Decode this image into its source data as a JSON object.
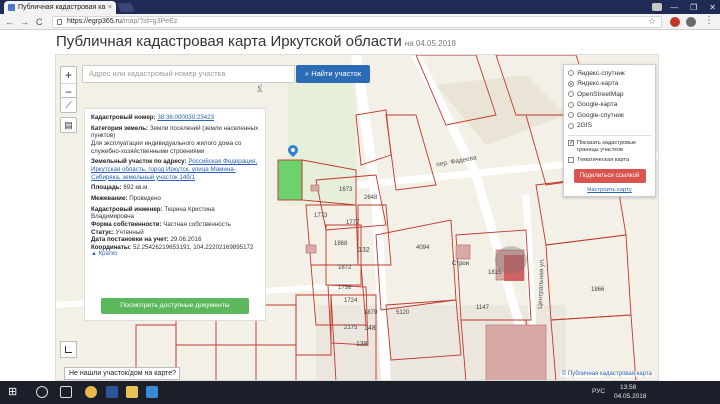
{
  "browser": {
    "tab_title": "Публичная кадастровая ка",
    "tab_close": "×",
    "url_host": "https://egrp365.ru",
    "url_path": "/map/?id=g3PeEz",
    "back": "←",
    "forward": "→",
    "reload": "C",
    "star": "☆",
    "menu": "⋮",
    "window_controls": [
      "—",
      "❐",
      "✕"
    ]
  },
  "page": {
    "title": "Публичная кадастровая карта Иркутской области",
    "date": "на 04.05.2018"
  },
  "map": {
    "zoom_in": "+",
    "zoom_out": "−",
    "search_placeholder": "Адрес или кадастровый номер участка",
    "search_button": "Найти участок",
    "not_found": "Не нашли участок/дом на карте?",
    "attribution": "© Публичная кадастровая карта",
    "labels": {
      "street1": "ул. Ма",
      "street2": "пер. Фадеева",
      "street3": "Центральная ул.",
      "l1": "1673",
      "l2": "2648",
      "l3": "1773",
      "l4": "1777",
      "l5": "1868",
      "l6": "132",
      "l7": "1872",
      "l8": "1738",
      "l9": "1724",
      "l10": "1879",
      "l11": "2175",
      "l12": "148",
      "l13": "5120",
      "l14": "4094",
      "l15": "1815",
      "l16": "1147",
      "l17": "1866",
      "l18": "138"
    },
    "map_marker_label": "Строи",
    "layers": {
      "options": [
        "Яндекс-спутник",
        "Яндекс-карта",
        "OpenStreetMap",
        "Google-карта",
        "Google-спутник",
        "2GIS"
      ],
      "selected": "Яндекс-карта",
      "show_boundaries": "Показать кадастровые границы участков",
      "thematic_map": "Тематическая карта",
      "share_button": "Поделиться ссылкой",
      "settings_link": "Настроить карту"
    },
    "info": {
      "cadnum_label": "Кадастровый номер:",
      "cadnum_value": "38:36:000030:23423",
      "category_label": "Категория земель:",
      "category_value": "Земли поселений (земли населенных пунктов)",
      "usage": "Для эксплуатации индивидуального жилого дома со служебно-хозяйственными строениями",
      "address_label": "Земельный участок по адресу:",
      "address_value": "Российская Федерация, Иркутская область, город Иркутск, улица Мамина-Сибиряка, земельный участок 14б/1",
      "area_label": "Площадь:",
      "area_value": "692 кв.м.",
      "survey_label": "Межевание:",
      "survey_value": "Проведено",
      "engineer_label": "Кадастровый инженер:",
      "engineer_value": "Тюрина Кристина Владимировна",
      "ownership_label": "Форма собственности:",
      "ownership_value": "Частная собственность",
      "status_label": "Статус:",
      "status_value": "Учтенный",
      "regdate_label": "Дата постановки на учет:",
      "regdate_value": "29.06.2016",
      "coords_label": "Координаты:",
      "coords_value": "52.25426219653191, 104.22202169895172",
      "collapse": "▲ Кратко",
      "docs_button": "Посмотреть доступные документы"
    }
  },
  "taskbar": {
    "lang": "РУС",
    "time": "13:58",
    "date": "04.05.2018"
  },
  "colors": {
    "accent_blue": "#2c6bb5",
    "share_red": "#d9534f",
    "docs_green": "#5cb85c",
    "parcel_red": "#c0392b"
  }
}
